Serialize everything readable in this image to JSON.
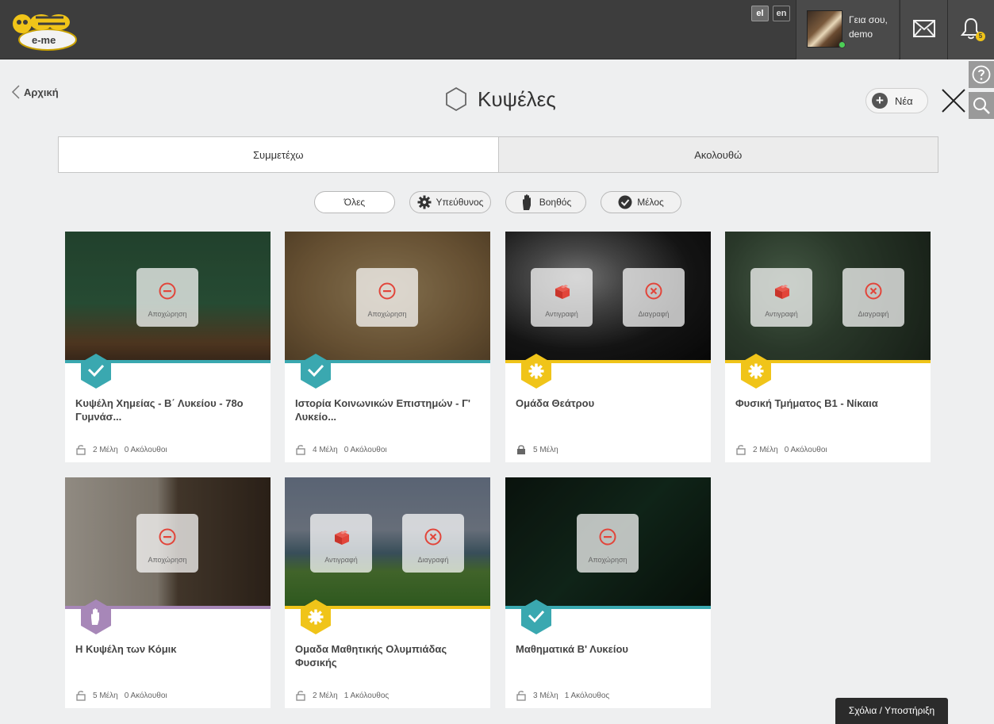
{
  "header": {
    "logo_text": "e-me",
    "languages": [
      {
        "code": "el",
        "active": true
      },
      {
        "code": "en",
        "active": false
      }
    ],
    "greeting_line1": "Γεια σου,",
    "greeting_line2": "demo",
    "notification_count": "5"
  },
  "page": {
    "back_label": "Αρχική",
    "title": "Κυψέλες",
    "new_label": "Νέα"
  },
  "tabs": [
    {
      "label": "Συμμετέχω",
      "active": true
    },
    {
      "label": "Ακολουθώ",
      "active": false
    }
  ],
  "filters": [
    {
      "label": "Όλες",
      "icon": "none",
      "active": true
    },
    {
      "label": "Υπεύθυνος",
      "icon": "gear-icon"
    },
    {
      "label": "Βοηθός",
      "icon": "hand-icon"
    },
    {
      "label": "Μέλος",
      "icon": "check-icon"
    }
  ],
  "colors": {
    "member": "#3aa8b0",
    "owner": "#f0c419",
    "assistant": "#a787b8",
    "action_red": "#e2453a"
  },
  "actions": {
    "leave": "Αποχώρηση",
    "copy": "Αντιγραφή",
    "delete": "Διαγραφή"
  },
  "hives": [
    {
      "title": "Κυψέλη Χημείας - Β΄ Λυκείου - 78ο Γυμνάσ...",
      "role": "member",
      "members": "2 Μέλη",
      "followers": "0 Ακόλουθοι",
      "locked": false,
      "actions": [
        "leave"
      ],
      "image": "chemistry"
    },
    {
      "title": "Ιστορία Κοινωνικών Επιστημών - Γ' Λυκείο...",
      "role": "member",
      "members": "4 Μέλη",
      "followers": "0 Ακόλουθοι",
      "locked": false,
      "actions": [
        "leave"
      ],
      "image": "vitruvian"
    },
    {
      "title": "Ομάδα Θεάτρου",
      "role": "owner",
      "members": "5 Μέλη",
      "followers": "",
      "locked": true,
      "actions": [
        "copy",
        "delete"
      ],
      "image": "masks"
    },
    {
      "title": "Φυσική Τμήματος Β1 - Νίκαια",
      "role": "owner",
      "members": "2 Μέλη",
      "followers": "0 Ακόλουθοι",
      "locked": false,
      "actions": [
        "copy",
        "delete"
      ],
      "image": "physics"
    },
    {
      "title": "Η Κυψέλη των Κόμικ",
      "role": "assistant",
      "members": "5 Μέλη",
      "followers": "0 Ακόλουθοι",
      "locked": false,
      "actions": [
        "leave"
      ],
      "image": "comic"
    },
    {
      "title": "Ομαδα Μαθητικής Ολυμπιάδας Φυσικής",
      "role": "owner",
      "members": "2 Μέλη",
      "followers": "1 Ακόλουθος",
      "locked": false,
      "actions": [
        "copy",
        "delete"
      ],
      "image": "beach"
    },
    {
      "title": "Μαθηματικά Β' Λυκείου",
      "role": "member",
      "members": "3 Μέλη",
      "followers": "1 Ακόλουθος",
      "locked": false,
      "actions": [
        "leave"
      ],
      "image": "math"
    }
  ],
  "footer": {
    "feedback_label": "Σχόλια / Υποστήριξη"
  }
}
